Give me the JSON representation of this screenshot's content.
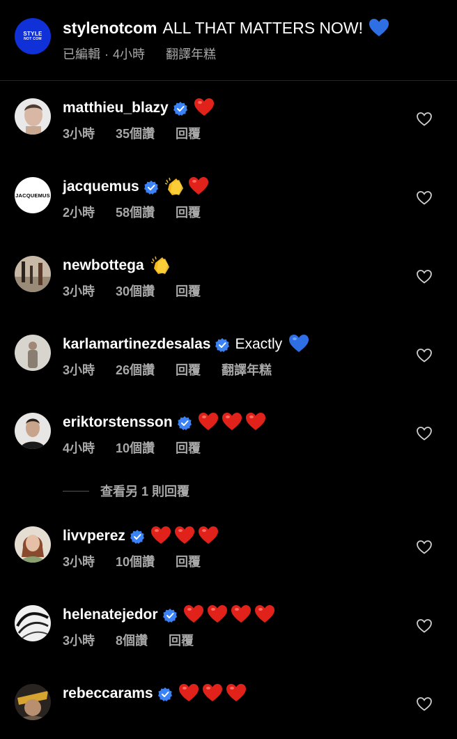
{
  "colors": {
    "background": "#000000",
    "text": "#ffffff",
    "muted": "#a8a8a8",
    "verified": "#3b82f6",
    "avatar_brand": "#1030d8"
  },
  "caption": {
    "avatar_text_top": "STYLE",
    "avatar_text_bottom": "NOT COM",
    "username": "stylenotcom",
    "text": "ALL THAT MATTERS NOW!",
    "emoji": "blue-heart",
    "edited": "已編輯",
    "separator": "·",
    "time": "4小時",
    "translate": "翻譯年糕"
  },
  "comments": [
    {
      "username": "matthieu_blazy",
      "verified": true,
      "text": "",
      "emojis": [
        "red-heart"
      ],
      "time": "3小時",
      "likes": "35個讚",
      "reply": "回覆",
      "translate": ""
    },
    {
      "username": "jacquemus",
      "verified": true,
      "avatar_text": "JACQUEMUS",
      "text": "",
      "emojis": [
        "clapping-hands",
        "red-heart"
      ],
      "time": "2小時",
      "likes": "58個讚",
      "reply": "回覆",
      "translate": ""
    },
    {
      "username": "newbottega",
      "verified": false,
      "text": "",
      "emojis": [
        "clapping-hands"
      ],
      "time": "3小時",
      "likes": "30個讚",
      "reply": "回覆",
      "translate": ""
    },
    {
      "username": "karlamartinezdesalas",
      "verified": true,
      "text": "Exactly",
      "emojis": [
        "blue-heart"
      ],
      "time": "3小時",
      "likes": "26個讚",
      "reply": "回覆",
      "translate": "翻譯年糕"
    },
    {
      "username": "eriktorstensson",
      "verified": true,
      "text": "",
      "emojis": [
        "red-heart",
        "red-heart",
        "red-heart"
      ],
      "time": "4小時",
      "likes": "10個讚",
      "reply": "回覆",
      "translate": ""
    },
    {
      "username": "livvperez",
      "verified": true,
      "text": "",
      "emojis": [
        "red-heart",
        "red-heart",
        "red-heart"
      ],
      "time": "3小時",
      "likes": "10個讚",
      "reply": "回覆",
      "translate": ""
    },
    {
      "username": "helenatejedor",
      "verified": true,
      "text": "",
      "emojis": [
        "red-heart",
        "red-heart",
        "red-heart",
        "red-heart"
      ],
      "time": "3小時",
      "likes": "8個讚",
      "reply": "回覆",
      "translate": ""
    },
    {
      "username": "rebeccarams",
      "verified": true,
      "text": "",
      "emojis": [
        "red-heart",
        "red-heart",
        "red-heart"
      ],
      "time": "",
      "likes": "",
      "reply": "",
      "translate": ""
    }
  ],
  "view_replies": "查看另 1 則回覆"
}
